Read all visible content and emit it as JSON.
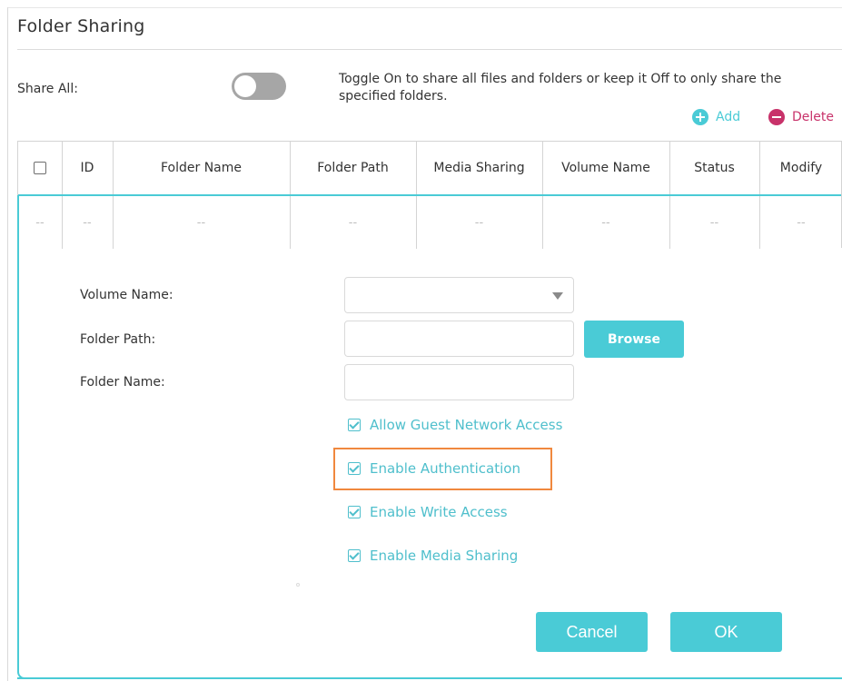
{
  "page": {
    "title": "Folder Sharing"
  },
  "share_all": {
    "label": "Share All:",
    "toggle_on": false,
    "description": "Toggle On to share all files and folders or keep it Off to only share the specified folders."
  },
  "actions": {
    "add_label": "Add",
    "delete_label": "Delete"
  },
  "table": {
    "columns": [
      "ID",
      "Folder Name",
      "Folder Path",
      "Media Sharing",
      "Volume Name",
      "Status",
      "Modify"
    ],
    "row": [
      "--",
      "--",
      "--",
      "--",
      "--",
      "--",
      "--",
      "--"
    ]
  },
  "form": {
    "volume_name_label": "Volume Name:",
    "volume_name_value": "",
    "folder_path_label": "Folder Path:",
    "folder_path_value": "",
    "browse_label": "Browse",
    "folder_name_label": "Folder Name:",
    "folder_name_value": "",
    "options": [
      {
        "label": "Allow Guest Network Access",
        "checked": true
      },
      {
        "label": "Enable Authentication",
        "checked": true
      },
      {
        "label": "Enable Write Access",
        "checked": true
      },
      {
        "label": "Enable Media Sharing",
        "checked": true
      }
    ]
  },
  "buttons": {
    "cancel": "Cancel",
    "ok": "OK"
  },
  "colors": {
    "accent": "#4acbd6",
    "delete": "#c8326a",
    "highlight": "#f0883e",
    "toggle_off": "#a6a6a6"
  }
}
